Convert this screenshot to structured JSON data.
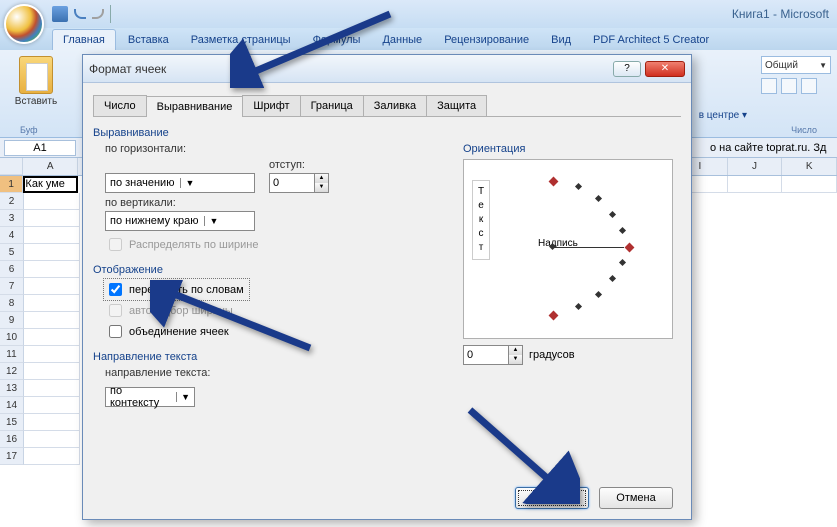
{
  "app": {
    "title": "Книга1 - Microsoft"
  },
  "ribbon": {
    "tabs": [
      "Главная",
      "Вставка",
      "Разметка страницы",
      "Формулы",
      "Данные",
      "Рецензирование",
      "Вид",
      "PDF Architect 5 Creator"
    ],
    "paste": "Вставить",
    "group_buf": "Буф",
    "center": "в центре ▾",
    "number_format": "Общий",
    "group_num": "Число"
  },
  "sheet": {
    "namebox": "A1",
    "formula": "о на сайте toprat.ru. Зд",
    "a1": "Как уме",
    "cols_right": [
      "I",
      "J",
      "K"
    ]
  },
  "dialog": {
    "title": "Формат ячеек",
    "help": "?",
    "close": "✕",
    "tabs": {
      "number": "Число",
      "align": "Выравнивание",
      "font": "Шрифт",
      "border": "Граница",
      "fill": "Заливка",
      "protect": "Защита"
    },
    "sections": {
      "alignment": "Выравнивание",
      "horiz_lbl": "по горизонтали:",
      "horiz_val": "по значению",
      "indent_lbl": "отступ:",
      "indent_val": "0",
      "vert_lbl": "по вертикали:",
      "vert_val": "по нижнему краю",
      "distribute": "Распределять по ширине",
      "display": "Отображение",
      "wrap": "переносить по словам",
      "shrink": "автоподбор ширины",
      "merge": "объединение ячеек",
      "textdir": "Направление текста",
      "textdir_lbl": "направление текста:",
      "textdir_val": "по контексту",
      "orientation": "Ориентация",
      "vtext": "Т\nе\nк\nс\nт",
      "nadpis": "Надпись",
      "deg_val": "0",
      "deg_lbl": "градусов"
    },
    "buttons": {
      "ok": "ОК",
      "cancel": "Отмена"
    }
  }
}
